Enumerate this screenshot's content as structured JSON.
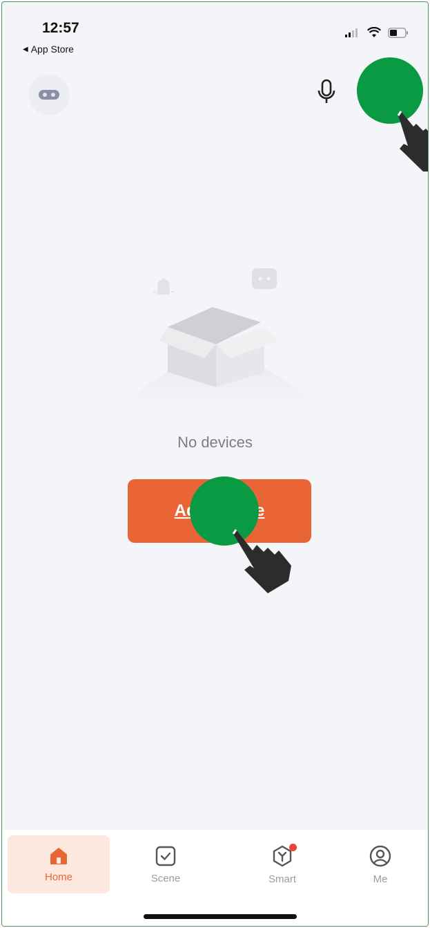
{
  "status_bar": {
    "time": "12:57",
    "back_app_label": "App Store"
  },
  "header": {
    "avatar_icon": "home-avatar-icon",
    "mic_icon": "microphone-icon",
    "add_icon": "add-icon"
  },
  "empty_state": {
    "message": "No devices",
    "button_label": "Add Device"
  },
  "tabs": [
    {
      "label": "Home",
      "icon": "home-icon",
      "active": true
    },
    {
      "label": "Scene",
      "icon": "scene-checkbox-icon",
      "active": false
    },
    {
      "label": "Smart",
      "icon": "smart-icon",
      "active": false
    },
    {
      "label": "Me",
      "icon": "profile-icon",
      "active": false
    }
  ],
  "colors": {
    "accent": "#ea6535",
    "tap_marker": "#0a9a44",
    "background": "#f4f5f8"
  }
}
